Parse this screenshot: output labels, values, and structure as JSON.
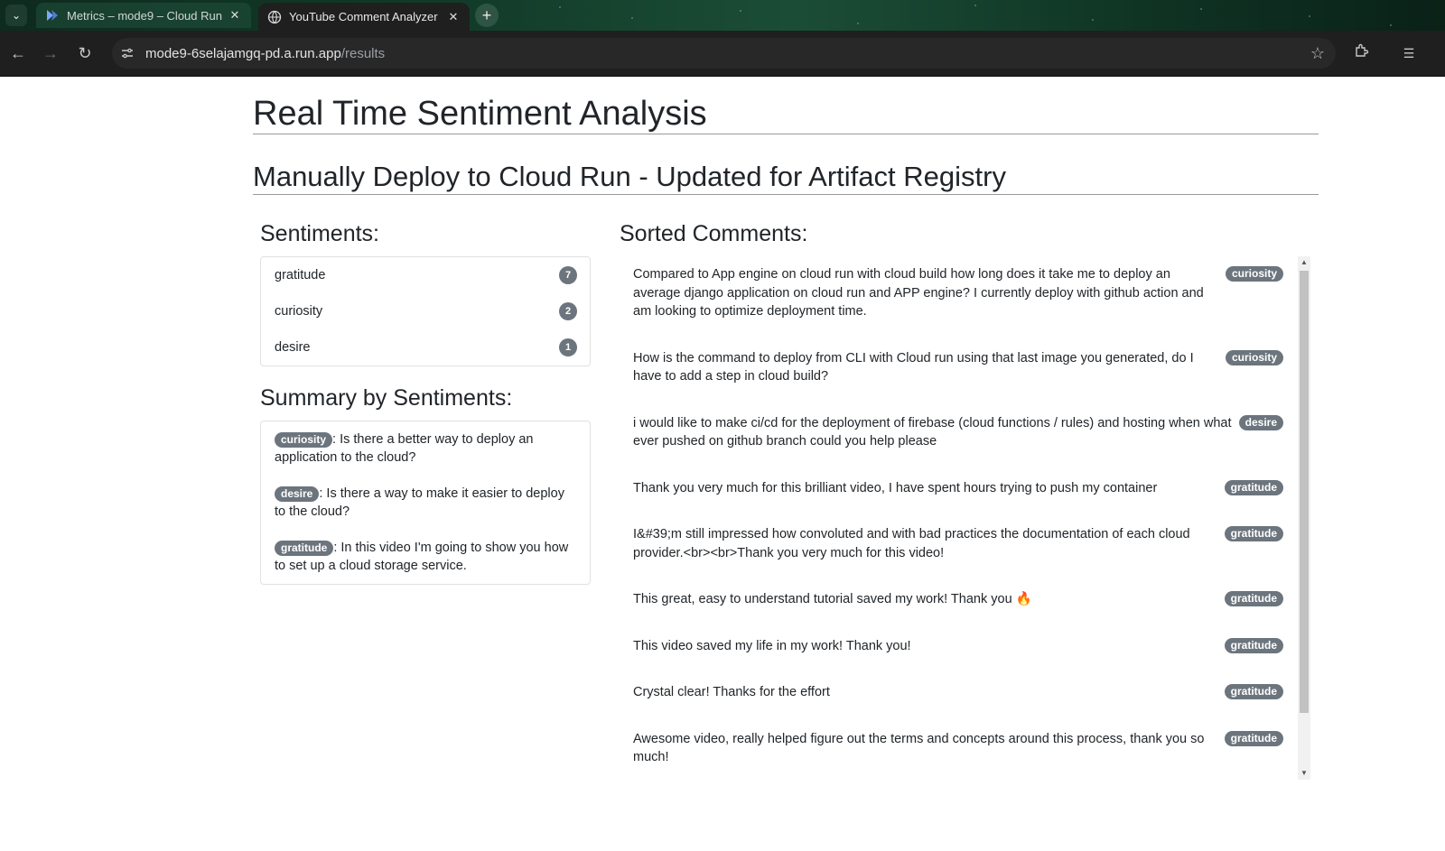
{
  "browser": {
    "tabs": [
      {
        "title": "Metrics – mode9 – Cloud Run",
        "icon": "cloud-run-icon",
        "active": false
      },
      {
        "title": "YouTube Comment Analyzer",
        "icon": "globe-icon",
        "active": true
      }
    ],
    "url_host": "mode9-6selajamgq-pd.a.run.app",
    "url_path": "/results"
  },
  "page": {
    "title": "Real Time Sentiment Analysis",
    "video_title": "Manually Deploy to Cloud Run - Updated for Artifact Registry"
  },
  "sentiments": {
    "heading": "Sentiments:",
    "items": [
      {
        "label": "gratitude",
        "count": "7"
      },
      {
        "label": "curiosity",
        "count": "2"
      },
      {
        "label": "desire",
        "count": "1"
      }
    ]
  },
  "summary": {
    "heading": "Summary by Sentiments:",
    "items": [
      {
        "tag": "curiosity",
        "text": ": Is there a better way to deploy an application to the cloud?"
      },
      {
        "tag": "desire",
        "text": ": Is there a way to make it easier to deploy to the cloud?"
      },
      {
        "tag": "gratitude",
        "text": ": In this video I'm going to show you how to set up a cloud storage service."
      }
    ]
  },
  "comments": {
    "heading": "Sorted Comments:",
    "items": [
      {
        "text": "Compared to App engine on cloud run with cloud build how long does it take me to deploy an average django application on cloud run and APP engine? I currently deploy with github action and am looking to optimize deployment time.",
        "tag": "curiosity"
      },
      {
        "text": "How is the command to deploy from CLI with Cloud run using that last image you generated, do I have to add a step in cloud build?",
        "tag": "curiosity"
      },
      {
        "text": "i would like to make ci/cd for the deployment of firebase (cloud functions / rules) and hosting when what ever pushed on github branch could you help please",
        "tag": "desire"
      },
      {
        "text": "Thank you very much for this brilliant video, I have spent hours trying to push my container",
        "tag": "gratitude"
      },
      {
        "text": "I&#39;m still impressed how convoluted and with bad practices the documentation of each cloud provider.<br><br>Thank you very much for this video!",
        "tag": "gratitude"
      },
      {
        "text": "This great, easy to understand tutorial saved my work! Thank you 🔥",
        "tag": "gratitude"
      },
      {
        "text": "This video saved my life in my work! Thank you!",
        "tag": "gratitude"
      },
      {
        "text": "Crystal clear! Thanks for the effort",
        "tag": "gratitude"
      },
      {
        "text": "Awesome video, really helped figure out the terms and concepts around this process, thank you so much!",
        "tag": "gratitude"
      }
    ]
  },
  "colors": {
    "badge": "#6c757d",
    "text": "#212529"
  }
}
